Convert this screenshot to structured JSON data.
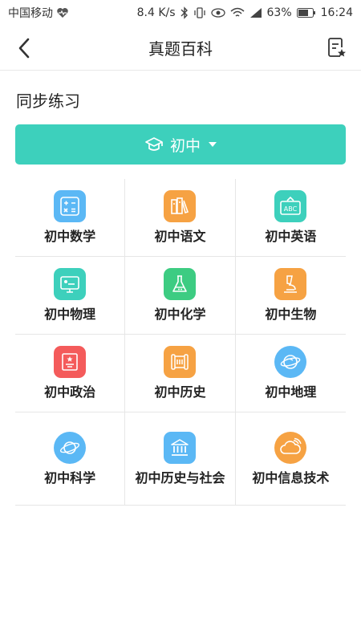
{
  "status_bar": {
    "carrier": "中国移动",
    "speed": "8.4 K/s",
    "battery": "63%",
    "time": "16:24"
  },
  "nav": {
    "title": "真题百科"
  },
  "section": {
    "title": "同步练习"
  },
  "grade_selector": {
    "label": "初中"
  },
  "subjects": [
    {
      "label": "初中数学",
      "icon": "calculator-icon",
      "color": "#5bb8f5"
    },
    {
      "label": "初中语文",
      "icon": "books-icon",
      "color": "#f6a243"
    },
    {
      "label": "初中英语",
      "icon": "abc-board-icon",
      "color": "#3dd0bc"
    },
    {
      "label": "初中物理",
      "icon": "monitor-icon",
      "color": "#3dd0bc"
    },
    {
      "label": "初中化学",
      "icon": "flask-icon",
      "color": "#3dcc82"
    },
    {
      "label": "初中生物",
      "icon": "microscope-icon",
      "color": "#f6a243"
    },
    {
      "label": "初中政治",
      "icon": "emblem-icon",
      "color": "#f45b5b"
    },
    {
      "label": "初中历史",
      "icon": "scroll-icon",
      "color": "#f6a243"
    },
    {
      "label": "初中地理",
      "icon": "globe-icon",
      "color": "#5bb8f5"
    },
    {
      "label": "初中科学",
      "icon": "planet-icon",
      "color": "#5bb8f5"
    },
    {
      "label": "初中历史与社会",
      "icon": "museum-icon",
      "color": "#5bb8f5"
    },
    {
      "label": "初中信息技术",
      "icon": "cloud-icon",
      "color": "#f6a243"
    }
  ]
}
